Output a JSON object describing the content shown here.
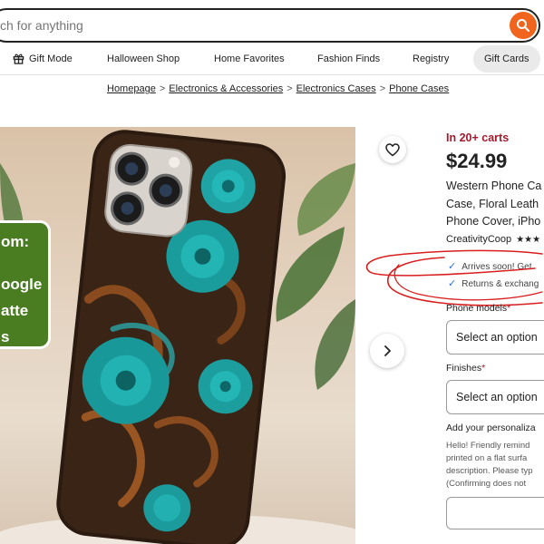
{
  "search": {
    "placeholder": "ch for anything"
  },
  "nav": {
    "items": [
      {
        "label": "Gift Mode"
      },
      {
        "label": "Halloween Shop"
      },
      {
        "label": "Home Favorites"
      },
      {
        "label": "Fashion Finds"
      },
      {
        "label": "Registry"
      },
      {
        "label": "Gift Cards"
      }
    ]
  },
  "breadcrumb": {
    "items": [
      "Homepage",
      "Electronics & Accessories",
      "Electronics Cases",
      "Phone Cases"
    ],
    "separator": ">"
  },
  "image": {
    "promo_lines": [
      "om:",
      "",
      "oogle",
      "atte",
      "s"
    ]
  },
  "listing": {
    "in_carts": "In 20+ carts",
    "price": "$24.99",
    "title_lines": [
      "Western Phone Ca",
      "Case, Floral Leath",
      "Phone Cover, iPho"
    ],
    "seller": "CreativityCoop",
    "stars": "★★★",
    "features": [
      "Arrives soon! Get",
      "Returns & exchang"
    ]
  },
  "options": {
    "phone_models_label": "Phone models",
    "phone_models_value": "Select an option",
    "finishes_label": "Finishes",
    "finishes_value": "Select an option",
    "required_mark": "*"
  },
  "personalization": {
    "label": "Add your personaliza",
    "instructions": [
      "Hello! Friendly remind",
      "printed on a flat surfa",
      "description. Please typ",
      "(Confirming does not"
    ]
  },
  "colors": {
    "brand_orange": "#f1641e",
    "in_carts_red": "#a61a2e",
    "promo_green": "#4a7c22",
    "annotation_red": "#d81e1e",
    "check_blue": "#2b6fd6"
  }
}
